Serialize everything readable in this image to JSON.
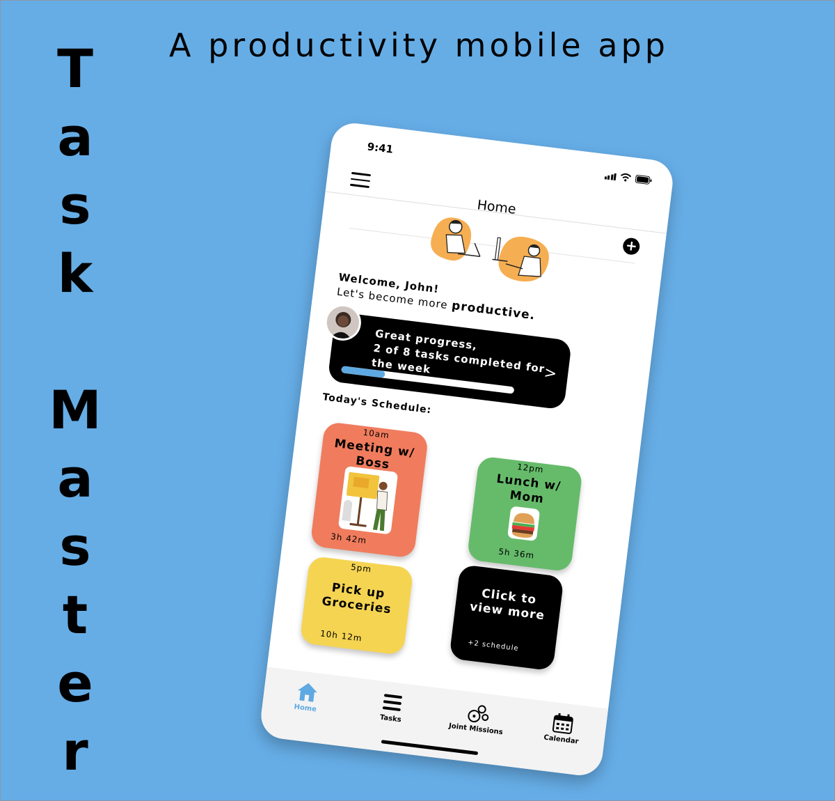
{
  "poster": {
    "vertical_title": [
      "T",
      "a",
      "s",
      "k",
      "",
      "M",
      "a",
      "s",
      "t",
      "e",
      "r"
    ],
    "tagline": "A productivity mobile app"
  },
  "status_bar": {
    "time": "9:41"
  },
  "header": {
    "title": "Home",
    "add_label": "+"
  },
  "welcome": {
    "line1": "Welcome, John!",
    "line2_prefix": "Let's become more ",
    "line2_emphasis": "productive."
  },
  "progress": {
    "line1": "Great progress,",
    "line2": "2 of 8 tasks completed for",
    "line3": "the week",
    "completed": 2,
    "total": 8,
    "chevron": ">"
  },
  "schedule": {
    "heading": "Today's Schedule:",
    "items": [
      {
        "time": "10am",
        "title_1": "Meeting w/",
        "title_2": "Boss",
        "duration": "3h 42m",
        "color": "#f07c5d"
      },
      {
        "time": "12pm",
        "title_1": "Lunch w/",
        "title_2": "Mom",
        "duration": "5h 36m",
        "color": "#66bb6a"
      },
      {
        "time": "5pm",
        "title_1": "Pick up",
        "title_2": "Groceries",
        "duration": "10h 12m",
        "color": "#f5d452"
      }
    ],
    "more": {
      "title_1": "Click to",
      "title_2": "view more",
      "sub": "+2 schedule"
    }
  },
  "tabs": [
    {
      "label": "Home",
      "icon": "home-icon",
      "active": true
    },
    {
      "label": "Tasks",
      "icon": "tasks-icon",
      "active": false
    },
    {
      "label": "Joint Missions",
      "icon": "joint-missions-icon",
      "active": false
    },
    {
      "label": "Calendar",
      "icon": "calendar-icon",
      "active": false
    }
  ],
  "colors": {
    "background": "#66ade6",
    "accent": "#5ea9e2"
  }
}
